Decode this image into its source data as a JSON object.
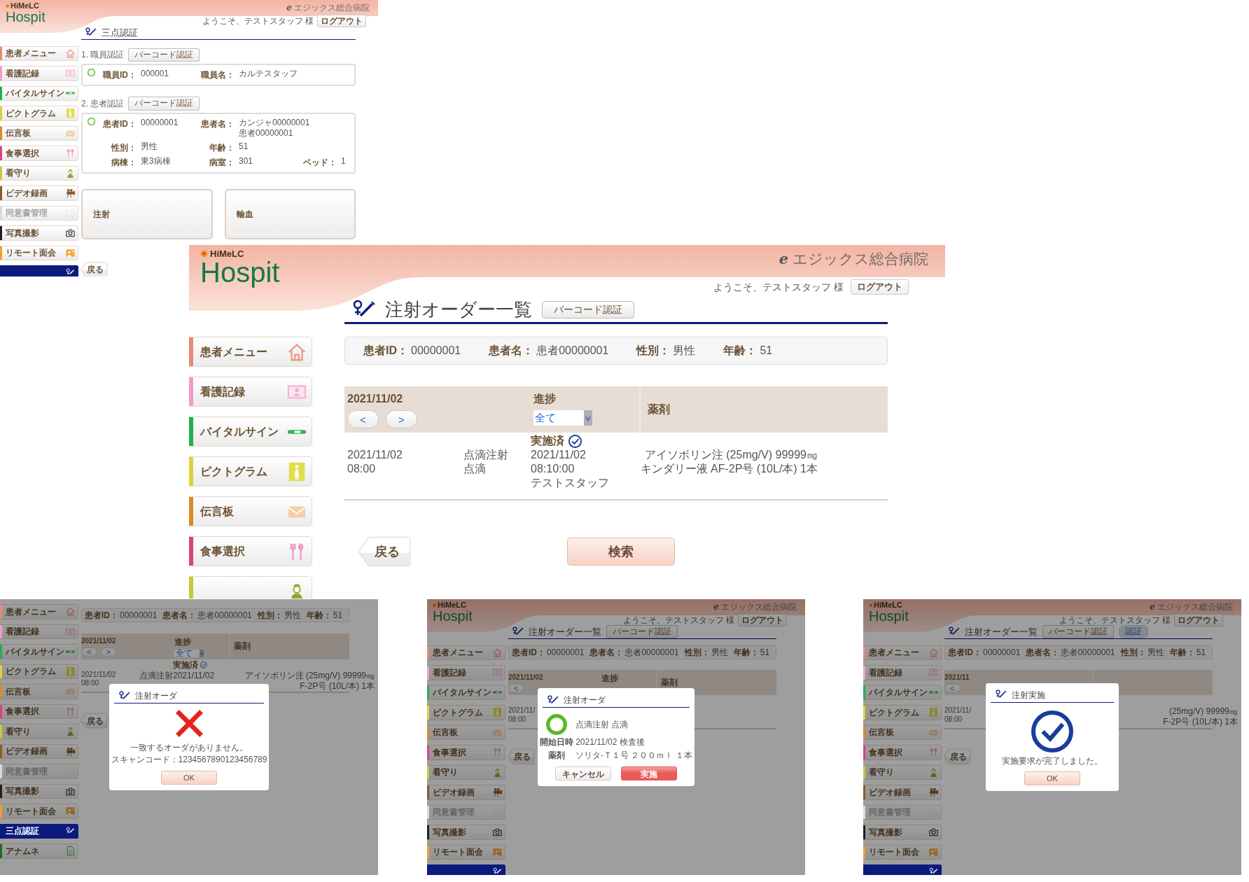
{
  "screens": [
    {
      "header": {
        "brand_small": "HiMeLC",
        "brand": "Hospit",
        "hospital_mark": "e",
        "hospital": "エジックス総合病院",
        "welcome": "ようこそ、テストスタッフ 様",
        "logout": "ログアウト"
      },
      "title": {
        "text": "三点認証"
      },
      "sidebar": [
        {
          "label": "患者メニュー",
          "color": "#e98a73",
          "selected": false,
          "disabled": false
        },
        {
          "label": "看護記録",
          "color": "#f49ac9",
          "selected": false,
          "disabled": false
        },
        {
          "label": "バイタルサイン",
          "color": "#1db34a",
          "selected": false,
          "disabled": false
        },
        {
          "label": "ピクトグラム",
          "color": "#ddd23a",
          "selected": false,
          "disabled": false
        },
        {
          "label": "伝言板",
          "color": "#db8a2c",
          "selected": false,
          "disabled": false
        },
        {
          "label": "食事選択",
          "color": "#d9437c",
          "selected": false,
          "disabled": false
        },
        {
          "label": "看守り",
          "color": "#c7c93a",
          "selected": false,
          "disabled": false
        },
        {
          "label": "ビデオ録画",
          "color": "#8b5a28",
          "selected": false,
          "disabled": false
        },
        {
          "label": "同意書管理",
          "color": "#d9d9d9",
          "selected": false,
          "disabled": true
        },
        {
          "label": "写真撮影",
          "color": "#1f1f1f",
          "selected": false,
          "disabled": false
        },
        {
          "label": "リモート面会",
          "color": "#f0a02a",
          "selected": false,
          "disabled": false
        },
        {
          "color": "#0b1a7c",
          "selected": true,
          "disabled": false
        }
      ],
      "content": {
        "kind": "auth",
        "sections": [
          {
            "label": "1. 職員認証",
            "button": "バーコード認証",
            "verified": true,
            "rows": [
              [
                {
                  "label": "職員ID：",
                  "value": [
                    "000001"
                  ]
                },
                {
                  "label": "職員名：",
                  "value": [
                    "カルテスタッフ"
                  ]
                }
              ]
            ]
          },
          {
            "label": "2. 患者認証",
            "button": "バーコード認証",
            "verified": true,
            "rows": [
              [
                {
                  "label": "患者ID：",
                  "value": [
                    "00000001"
                  ]
                },
                {
                  "label": "患者名：",
                  "value": [
                    "カンジャ00000001",
                    "患者00000001"
                  ]
                }
              ],
              [
                {
                  "label": "性別：",
                  "value": [
                    "男性"
                  ]
                },
                {
                  "label": "年齢：",
                  "value": [
                    "51"
                  ]
                }
              ],
              [
                {
                  "label": "病棟：",
                  "value": [
                    "東3病棟"
                  ]
                },
                {
                  "label": "病室：",
                  "value": [
                    "301"
                  ]
                },
                {
                  "label": "ベッド：",
                  "value": [
                    "1"
                  ]
                }
              ]
            ]
          }
        ],
        "actions": [
          "注射",
          "輸血"
        ],
        "back": "戻る"
      }
    },
    {
      "header": {
        "brand_small": "HiMeLC",
        "brand": "Hospit",
        "hospital_mark": "e",
        "hospital": "エジックス総合病院",
        "welcome": "ようこそ、テストスタッフ 様",
        "logout": "ログアウト"
      },
      "title": {
        "text": "注射オーダー一覧",
        "buttons": [
          {
            "label": "バーコード認証",
            "kind": "plain"
          }
        ]
      },
      "sidebar": [
        {
          "label": "患者メニュー",
          "color": "#e98a73",
          "selected": false,
          "disabled": false
        },
        {
          "label": "看護記録",
          "color": "#f49ac9",
          "selected": false,
          "disabled": false
        },
        {
          "label": "バイタルサイン",
          "color": "#1db34a",
          "selected": false,
          "disabled": false
        },
        {
          "label": "ピクトグラム",
          "color": "#ddd23a",
          "selected": false,
          "disabled": false
        },
        {
          "label": "伝言板",
          "color": "#db8a2c",
          "selected": false,
          "disabled": false
        },
        {
          "label": "食事選択",
          "color": "#d9437c",
          "selected": false,
          "disabled": false
        },
        {
          "color": "#c7c93a",
          "selected": false,
          "disabled": false
        }
      ],
      "content": {
        "kind": "order_list",
        "patient": [
          {
            "label": "患者ID：",
            "value": "00000001"
          },
          {
            "label": "患者名：",
            "value": "患者00000001"
          },
          {
            "label": "性別：",
            "value": "男性"
          },
          {
            "label": "年齢：",
            "value": "51"
          }
        ],
        "table": {
          "date": "2021/11/02",
          "nav": [
            "<",
            ">"
          ],
          "progress_label": "進捗",
          "filter": "全て",
          "drug_label": "薬剤",
          "rows": [
            {
              "datetime": [
                "2021/11/02",
                "08:00"
              ],
              "category": [
                "点滴注射",
                "点滴"
              ],
              "status": "実施済",
              "done": true,
              "progress": [
                "2021/11/02",
                "08:10:00",
                "テストスタッフ"
              ],
              "drugs": [
                "アイソボリン注 (25mg/V) 99999㎎",
                "キンダリー液 AF-2P号 (10L/本) 1本"
              ]
            }
          ]
        },
        "back": "戻る",
        "search": "検索"
      }
    },
    {
      "sidebar": [
        {
          "label": "患者メニュー",
          "color": "#e98a73",
          "selected": false,
          "disabled": false
        },
        {
          "label": "看護記録",
          "color": "#f49ac9",
          "selected": false,
          "disabled": false
        },
        {
          "label": "バイタルサイン",
          "color": "#1db34a",
          "selected": false,
          "disabled": false
        },
        {
          "label": "ピクトグラム",
          "color": "#ddd23a",
          "selected": false,
          "disabled": false
        },
        {
          "label": "伝言板",
          "color": "#db8a2c",
          "selected": false,
          "disabled": false
        },
        {
          "label": "食事選択",
          "color": "#d9437c",
          "selected": false,
          "disabled": false
        },
        {
          "label": "看守り",
          "color": "#c7c93a",
          "selected": false,
          "disabled": false
        },
        {
          "label": "ビデオ録画",
          "color": "#8b5a28",
          "selected": false,
          "disabled": false
        },
        {
          "label": "同意書管理",
          "color": "#d9d9d9",
          "selected": false,
          "disabled": true
        },
        {
          "label": "写真撮影",
          "color": "#1f1f1f",
          "selected": false,
          "disabled": false
        },
        {
          "label": "リモート面会",
          "color": "#f0a02a",
          "selected": false,
          "disabled": false
        },
        {
          "label": "三点認証",
          "color": "#0b1a7c",
          "selected": true,
          "disabled": false
        },
        {
          "label": "アナムネ",
          "color": "#1e6b22",
          "selected": false,
          "disabled": false
        }
      ],
      "content": {
        "kind": "order_list",
        "patient": [
          {
            "label": "患者ID：",
            "value": "00000001"
          },
          {
            "label": "患者名：",
            "value": "患者00000001"
          },
          {
            "label": "性別：",
            "value": "男性"
          },
          {
            "label": "年齢：",
            "value": "51"
          }
        ],
        "table": {
          "date": "2021/11/02",
          "nav": [
            "<",
            ">"
          ],
          "progress_label": "進捗",
          "filter": "全て",
          "drug_label": "薬剤",
          "rows": [
            {
              "datetime": [
                "2021/11/02",
                "08:00"
              ],
              "category": [
                "点滴注射"
              ],
              "status": "実施済",
              "done": true,
              "progress": [
                "2021/11/02"
              ],
              "drugs": [
                "アイソボリン注 (25mg/V) 99999㎎",
                "F-2P号 (10L/本) 1本"
              ]
            }
          ]
        },
        "back": "戻る"
      },
      "dialog": {
        "kind": "error",
        "title": "注射オーダ",
        "message": [
          "一致するオーダがありません。",
          "スキャンコード：1234567890123456789"
        ],
        "buttons": [
          {
            "label": "OK",
            "kind": "ok"
          }
        ]
      }
    },
    {
      "header": {
        "brand_small": "HiMeLC",
        "brand": "Hospit",
        "hospital_mark": "e",
        "hospital": "エジックス総合病院",
        "welcome": "ようこそ、テストスタッフ 様",
        "logout": "ログアウト"
      },
      "title": {
        "text": "注射オーダー一覧",
        "buttons": [
          {
            "label": "バーコード認証",
            "kind": "plain"
          }
        ]
      },
      "sidebar": [
        {
          "label": "患者メニュー",
          "color": "#e98a73",
          "selected": false,
          "disabled": false
        },
        {
          "label": "看護記録",
          "color": "#f49ac9",
          "selected": false,
          "disabled": false
        },
        {
          "label": "バイタルサイン",
          "color": "#1db34a",
          "selected": false,
          "disabled": false
        },
        {
          "label": "ピクトグラム",
          "color": "#ddd23a",
          "selected": false,
          "disabled": false
        },
        {
          "label": "伝言板",
          "color": "#db8a2c",
          "selected": false,
          "disabled": false
        },
        {
          "label": "食事選択",
          "color": "#d9437c",
          "selected": false,
          "disabled": false
        },
        {
          "label": "看守り",
          "color": "#c7c93a",
          "selected": false,
          "disabled": false
        },
        {
          "label": "ビデオ録画",
          "color": "#8b5a28",
          "selected": false,
          "disabled": false
        },
        {
          "label": "同意書管理",
          "color": "#d9d9d9",
          "selected": false,
          "disabled": true
        },
        {
          "label": "写真撮影",
          "color": "#1f1f1f",
          "selected": false,
          "disabled": false
        },
        {
          "label": "リモート面会",
          "color": "#f0a02a",
          "selected": false,
          "disabled": false
        },
        {
          "color": "#0b1a7c",
          "selected": true,
          "disabled": false
        }
      ],
      "content": {
        "kind": "order_list",
        "patient": [
          {
            "label": "患者ID：",
            "value": "00000001"
          },
          {
            "label": "患者名：",
            "value": "患者00000001"
          },
          {
            "label": "性別：",
            "value": "男性"
          },
          {
            "label": "年齢：",
            "value": "51"
          }
        ],
        "table": {
          "date": "2021/11/02",
          "nav": [
            "<"
          ],
          "progress_label": "進捗",
          "drug_label": "薬剤",
          "rows": [
            {
              "datetime": [
                "2021/11/",
                "08:00"
              ]
            }
          ]
        },
        "back": "戻る"
      },
      "dialog": {
        "kind": "confirm",
        "title": "注射オーダ",
        "summary": "点滴注射 点滴",
        "fields": [
          {
            "label": "開始日時",
            "value": "2021/11/02 検査後"
          },
          {
            "label": "薬剤",
            "value": "ソリタ-Ｔ１号 ２００ｍｌ １本"
          }
        ],
        "buttons": [
          {
            "label": "キャンセル",
            "kind": "cancel"
          },
          {
            "label": "実施",
            "kind": "primary"
          }
        ]
      }
    },
    {
      "header": {
        "brand_small": "HiMeLC",
        "brand": "Hospit",
        "hospital_mark": "e",
        "hospital": "エジックス総合病院",
        "welcome": "ようこそ、テストスタッフ 様",
        "logout": "ログアウト"
      },
      "title": {
        "text": "注射オーダー一覧",
        "buttons": [
          {
            "label": "バーコード認証",
            "kind": "plain"
          },
          {
            "label": "認証",
            "kind": "pill"
          }
        ]
      },
      "sidebar": [
        {
          "label": "患者メニュー",
          "color": "#e98a73",
          "selected": false,
          "disabled": false
        },
        {
          "label": "看護記録",
          "color": "#f49ac9",
          "selected": false,
          "disabled": false
        },
        {
          "label": "バイタルサイン",
          "color": "#1db34a",
          "selected": false,
          "disabled": false
        },
        {
          "label": "ピクトグラム",
          "color": "#ddd23a",
          "selected": false,
          "disabled": false
        },
        {
          "label": "伝言板",
          "color": "#db8a2c",
          "selected": false,
          "disabled": false
        },
        {
          "label": "食事選択",
          "color": "#d9437c",
          "selected": false,
          "disabled": false
        },
        {
          "label": "看守り",
          "color": "#c7c93a",
          "selected": false,
          "disabled": false
        },
        {
          "label": "ビデオ録画",
          "color": "#8b5a28",
          "selected": false,
          "disabled": false
        },
        {
          "label": "同意書管理",
          "color": "#d9d9d9",
          "selected": false,
          "disabled": true
        },
        {
          "label": "写真撮影",
          "color": "#1f1f1f",
          "selected": false,
          "disabled": false
        },
        {
          "label": "リモート面会",
          "color": "#f0a02a",
          "selected": false,
          "disabled": false
        },
        {
          "color": "#0b1a7c",
          "selected": true,
          "disabled": false
        }
      ],
      "content": {
        "kind": "order_list",
        "patient": [
          {
            "label": "患者ID：",
            "value": "00000001"
          },
          {
            "label": "患者名：",
            "value": "患者00000001"
          },
          {
            "label": "性別：",
            "value": "男性"
          },
          {
            "label": "年齢：",
            "value": "51"
          }
        ],
        "table": {
          "date": "2021/11",
          "nav": [
            "<"
          ],
          "rows": [
            {
              "datetime": [
                "2021/11/",
                "08:00"
              ],
              "drugs": [
                "(25mg/V) 99999㎎",
                "F-2P号 (10L/本) 1本"
              ]
            }
          ]
        },
        "back": "戻る"
      },
      "dialog": {
        "kind": "done",
        "title": "注射実施",
        "message": [
          "実施要求が完了しました。"
        ],
        "buttons": [
          {
            "label": "OK",
            "kind": "ok"
          }
        ]
      }
    }
  ]
}
